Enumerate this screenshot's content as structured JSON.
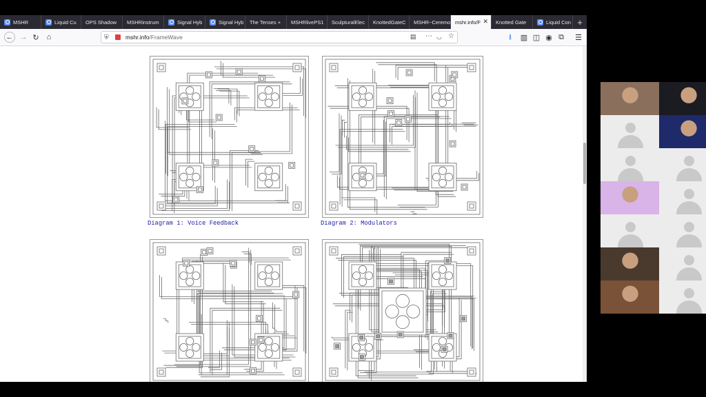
{
  "browser": {
    "tabs": [
      {
        "label": "MSHR",
        "active": false
      },
      {
        "label": "Liquid Cu",
        "active": false
      },
      {
        "label": "OPS Shadow",
        "active": false
      },
      {
        "label": "MSHRinstrum",
        "active": false
      },
      {
        "label": "Signal Hyb",
        "active": false
      },
      {
        "label": "Signal Hyb",
        "active": false
      },
      {
        "label": "The Tenses +",
        "active": false
      },
      {
        "label": "MSHRlivePS1",
        "active": false
      },
      {
        "label": "SculpturalElec",
        "active": false
      },
      {
        "label": "KnottedGateC",
        "active": false
      },
      {
        "label": "MSHR~Ceremo",
        "active": false
      },
      {
        "label": "mshr.info/F",
        "active": true
      },
      {
        "label": "Knotted Gate",
        "active": false
      },
      {
        "label": "Liquid Con",
        "active": false
      }
    ],
    "new_tab_label": "+",
    "url_domain": "mshr.info",
    "url_path": "/FrameWave"
  },
  "page": {
    "captions": {
      "diagram1": "Diagram 1: Voice Feedback",
      "diagram2": "Diagram 2: Modulators"
    }
  },
  "meeting": {
    "participants": [
      {
        "kind": "video",
        "color": "#8a6f5c"
      },
      {
        "kind": "video",
        "color": "#1b1b22"
      },
      {
        "kind": "placeholder"
      },
      {
        "kind": "video",
        "color": "#1f2a6a"
      },
      {
        "kind": "placeholder"
      },
      {
        "kind": "placeholder"
      },
      {
        "kind": "video",
        "color": "#d9b4e8"
      },
      {
        "kind": "placeholder"
      },
      {
        "kind": "placeholder"
      },
      {
        "kind": "placeholder"
      },
      {
        "kind": "video",
        "color": "#4a3a2e"
      },
      {
        "kind": "placeholder"
      },
      {
        "kind": "video",
        "color": "#7a5238"
      },
      {
        "kind": "placeholder"
      }
    ]
  },
  "colors": {
    "tab_bar": "#2b2a33",
    "caption_link": "#1a1aa8",
    "diagram_line": "#6a6a6a"
  }
}
